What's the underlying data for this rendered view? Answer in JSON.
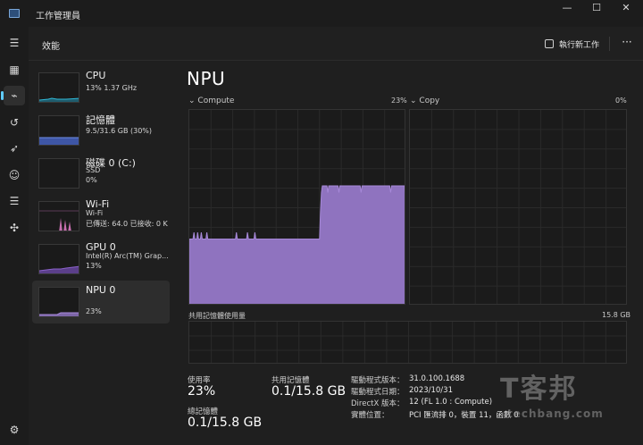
{
  "window": {
    "title": "工作管理員",
    "minimize_glyph": "—",
    "maximize_glyph": "☐",
    "close_glyph": "✕"
  },
  "rail": [
    {
      "name": "hamburger-menu-icon",
      "glyph": "☰",
      "active": false
    },
    {
      "name": "processes-icon",
      "glyph": "▦",
      "active": false
    },
    {
      "name": "performance-icon",
      "glyph": "⌁",
      "active": true
    },
    {
      "name": "app-history-icon",
      "glyph": "↺",
      "active": false
    },
    {
      "name": "startup-apps-icon",
      "glyph": "➶",
      "active": false
    },
    {
      "name": "users-icon",
      "glyph": "☺",
      "active": false
    },
    {
      "name": "details-icon",
      "glyph": "☰",
      "active": false
    },
    {
      "name": "services-icon",
      "glyph": "✣",
      "active": false
    },
    {
      "name": "settings-icon",
      "glyph": "⚙",
      "active": false
    }
  ],
  "header": {
    "title": "效能",
    "new_task_label": "執行新工作",
    "more_glyph": "···"
  },
  "resources": [
    {
      "name": "CPU",
      "line1": "13% 1.37 GHz",
      "line2": "",
      "color": "#2fb8d6"
    },
    {
      "name": "記憶體",
      "line1": "9.5/31.6 GB (30%)",
      "line2": "",
      "color": "#6f8fe6"
    },
    {
      "name": "磁碟 0 (C:)",
      "line1": "SSD",
      "line2": "0%",
      "color": "#7ab84a"
    },
    {
      "name": "Wi-Fi",
      "line1": "Wi-Fi",
      "line2": "已傳送: 64.0 已接收: 0 K",
      "color": "#c86fb0"
    },
    {
      "name": "GPU 0",
      "line1": "Intel(R) Arc(TM) Grap...",
      "line2": "13%",
      "color": "#8a62c9"
    },
    {
      "name": "NPU 0",
      "line1": "",
      "line2": "23%",
      "color": "#a688d8"
    }
  ],
  "main": {
    "title": "NPU",
    "compute_label": "Compute",
    "compute_pct": "23%",
    "copy_label": "Copy",
    "copy_pct": "0%",
    "shared_mem_label": "共用記憶體使用量",
    "shared_mem_max": "15.8 GB",
    "accent": "#a688d8"
  },
  "stats": {
    "utilization_label": "使用率",
    "utilization_value": "23%",
    "shared_label": "共用記憶體",
    "shared_value": "0.1/15.8 GB",
    "total_label": "總記憶體",
    "total_value": "0.1/15.8 GB"
  },
  "info": [
    {
      "key": "驅動程式版本：",
      "value": "31.0.100.1688"
    },
    {
      "key": "驅動程式日期：",
      "value": "2023/10/31"
    },
    {
      "key": "DirectX 版本：",
      "value": "12 (FL 1.0 : Compute)"
    },
    {
      "key": "實體位置：",
      "value": "PCI 匯流排 0，裝置 11，函數 0"
    }
  ],
  "compute_series": [
    10,
    10,
    10,
    10,
    10,
    11,
    10,
    10,
    10,
    11,
    10,
    10,
    10,
    11,
    10,
    10,
    10,
    10,
    10,
    11,
    10,
    10,
    10,
    10,
    10,
    10,
    10,
    10,
    10,
    10,
    10,
    10,
    10,
    10,
    10,
    10,
    10,
    10,
    10,
    10,
    10,
    10,
    10,
    10,
    10,
    10,
    10,
    10,
    10,
    10,
    10,
    11,
    10,
    10,
    10,
    10,
    10,
    10,
    10,
    10,
    10,
    10,
    10,
    11,
    10,
    10,
    10,
    10,
    10,
    10,
    10,
    11,
    10,
    10,
    10,
    10,
    10,
    10,
    10,
    10,
    10,
    10,
    10,
    10,
    10,
    10,
    10,
    10,
    10,
    10,
    10,
    10,
    10,
    10,
    10,
    10,
    10,
    10,
    10,
    10,
    10,
    10,
    10,
    10,
    10,
    10,
    10,
    10,
    10,
    10,
    10,
    10,
    10,
    10,
    10,
    10,
    10,
    10,
    10,
    10,
    10,
    10,
    10,
    10,
    10,
    10,
    10,
    10,
    10,
    10,
    10,
    10,
    10,
    10,
    10,
    10,
    10,
    10,
    10,
    10,
    10,
    10,
    14,
    17,
    18,
    18,
    18,
    18,
    18,
    18,
    17,
    18,
    18,
    18,
    18,
    18,
    18,
    18,
    18,
    18,
    18,
    18,
    17,
    18,
    18,
    18,
    18,
    18,
    18,
    18,
    18,
    18,
    18,
    18,
    18,
    18,
    18,
    18,
    18,
    18,
    18,
    18,
    18,
    18,
    18,
    18,
    17,
    18,
    18,
    18,
    18,
    18,
    18,
    18,
    18,
    18,
    18,
    18,
    18,
    18,
    18,
    18,
    18,
    18,
    18,
    18,
    18,
    18,
    18,
    18,
    18,
    18,
    18,
    18,
    18,
    18,
    18,
    18,
    17,
    18,
    18,
    18,
    18,
    18,
    18,
    18,
    18,
    18,
    18,
    18,
    18,
    18,
    18,
    18,
    16,
    17
  ],
  "watermark": {
    "text": "T客邦",
    "sub": "techbang.com"
  }
}
